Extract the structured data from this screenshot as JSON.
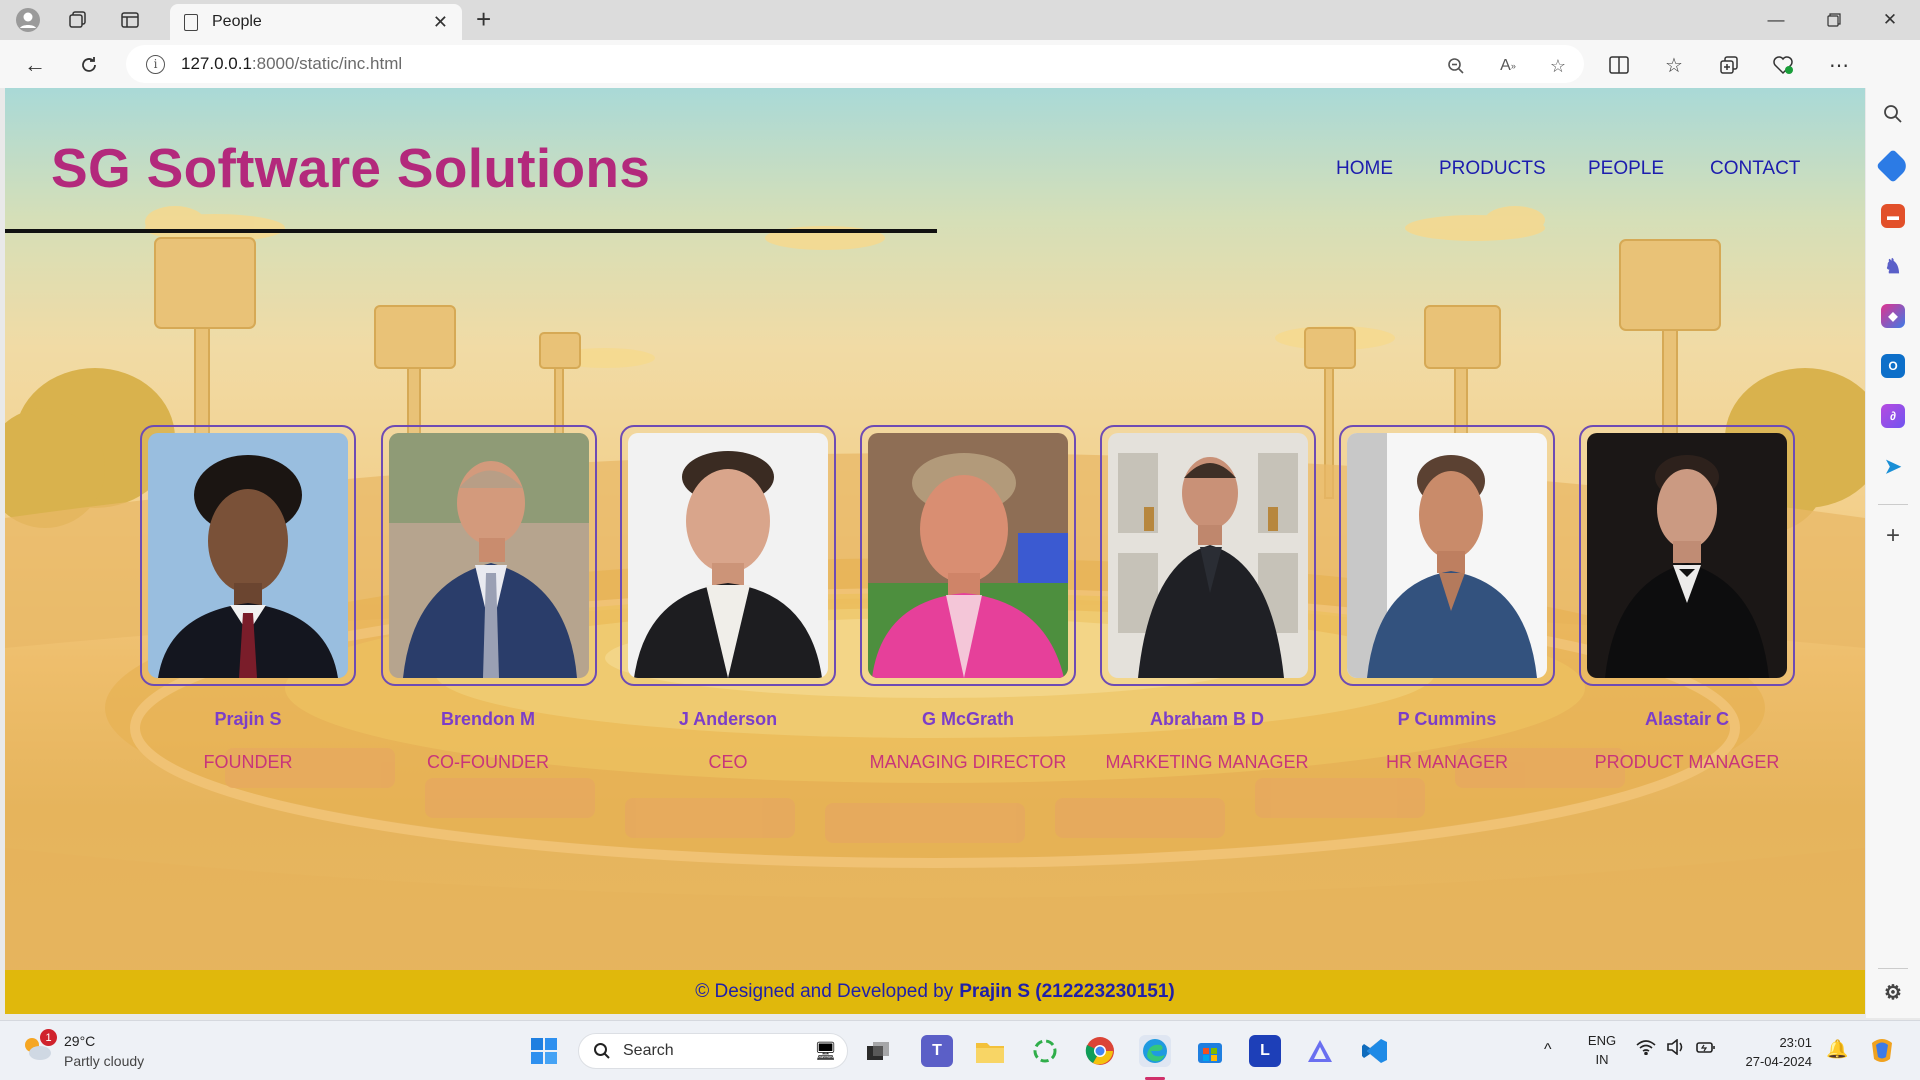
{
  "browser": {
    "tab_title": "People",
    "url_host": "127.0.0.1",
    "url_path": ":8000/static/inc.html"
  },
  "site": {
    "title": "SG Software Solutions",
    "nav": [
      "HOME",
      "PRODUCTS",
      "PEOPLE",
      "CONTACT"
    ],
    "people": [
      {
        "name": "Prajin S",
        "role": "FOUNDER"
      },
      {
        "name": "Brendon M",
        "role": "CO-FOUNDER"
      },
      {
        "name": "J Anderson",
        "role": "CEO"
      },
      {
        "name": "G McGrath",
        "role": "MANAGING DIRECTOR"
      },
      {
        "name": "Abraham B D",
        "role": "MARKETING MANAGER"
      },
      {
        "name": "P Cummins",
        "role": "HR MANAGER"
      },
      {
        "name": "Alastair C",
        "role": "PRODUCT MANAGER"
      }
    ],
    "footer_text": "© Designed and Developed by",
    "footer_author": "Prajin S (212223230151)"
  },
  "taskbar": {
    "weather_temp": "29°C",
    "weather_desc": "Partly cloudy",
    "weather_badge": "1",
    "search_label": "Search",
    "lang": "ENG",
    "region": "IN",
    "time": "23:01",
    "date": "27-04-2024"
  },
  "colors": {
    "title": "#b3297c",
    "nav": "#1d1dae",
    "person_name": "#7c3ec8",
    "person_role": "#c8357a",
    "footer_bg": "#e0b80c",
    "card_border": "#6e4bb4"
  }
}
